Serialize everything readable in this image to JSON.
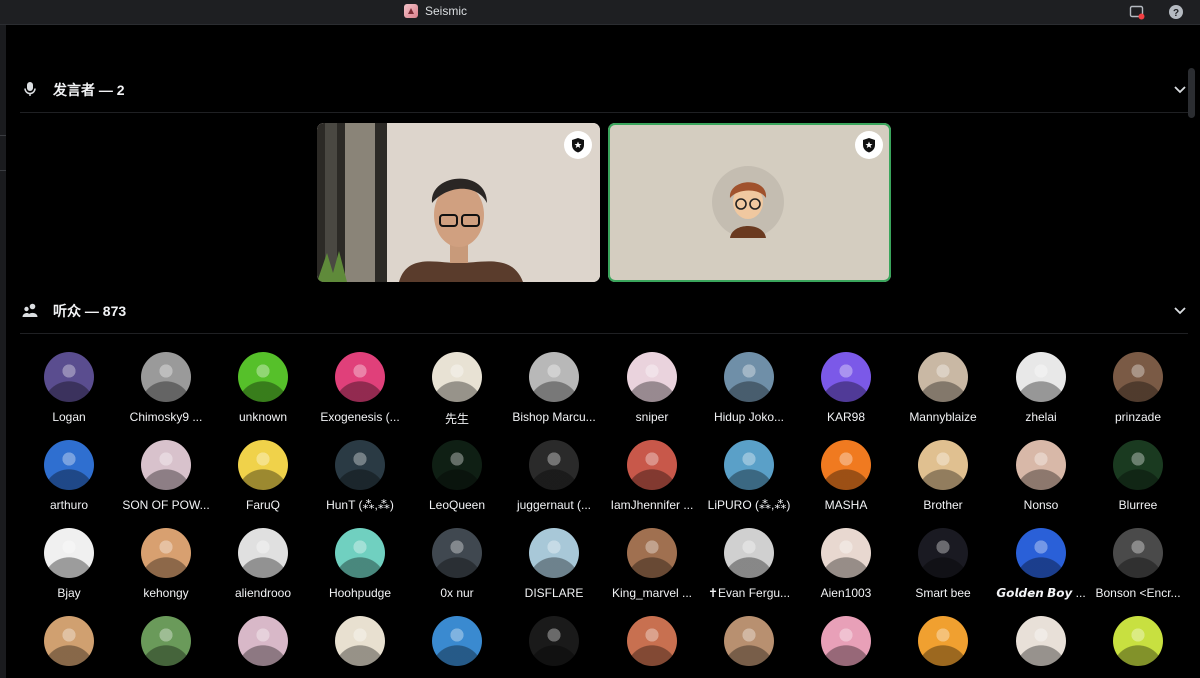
{
  "window": {
    "title": "Seismic"
  },
  "speakers": {
    "title": "发言者 — 2",
    "icon": "microphone-icon"
  },
  "audience": {
    "title": "听众 — 873",
    "icon": "people-icon",
    "members": [
      {
        "name": "Logan",
        "color": "#5a4d8f"
      },
      {
        "name": "Chimosky9 ...",
        "color": "#9a9a9a"
      },
      {
        "name": "unknown",
        "color": "#56c02a"
      },
      {
        "name": "Exogenesis (...",
        "color": "#e0407a"
      },
      {
        "name": "先生",
        "color": "#e8e2d4"
      },
      {
        "name": "Bishop Marcu...",
        "color": "#b8b8b8"
      },
      {
        "name": "sniper",
        "color": "#ead3dd"
      },
      {
        "name": "Hidup Joko...",
        "color": "#6f8fa8"
      },
      {
        "name": "KAR98",
        "color": "#7b59e8"
      },
      {
        "name": "Mannyblaize",
        "color": "#c9b8a4"
      },
      {
        "name": "zhelai",
        "color": "#e8e8e8"
      },
      {
        "name": "prinzade",
        "color": "#7a5a45"
      },
      {
        "name": "arthuro",
        "color": "#2f6fd0"
      },
      {
        "name": "SON OF POW...",
        "color": "#d8c2cc"
      },
      {
        "name": "FaruQ",
        "color": "#f0d24a"
      },
      {
        "name": "HunT (⁂,⁂)",
        "color": "#2a3a44"
      },
      {
        "name": "LeoQueen",
        "color": "#0f1f14"
      },
      {
        "name": "juggernaut (...",
        "color": "#2a2a2a"
      },
      {
        "name": "IamJhennifer ...",
        "color": "#c8584a"
      },
      {
        "name": "LiPURO (⁂,⁂)",
        "color": "#5aa0c8"
      },
      {
        "name": "MASHA",
        "color": "#f07a20"
      },
      {
        "name": "Brother",
        "color": "#e0c090"
      },
      {
        "name": "Nonso",
        "color": "#d8b8a8"
      },
      {
        "name": "Blurree",
        "color": "#1a3a20"
      },
      {
        "name": "Bjay",
        "color": "#f0f0f0"
      },
      {
        "name": "kehongy",
        "color": "#d8a070"
      },
      {
        "name": "aliendrooo",
        "color": "#e0e0e0"
      },
      {
        "name": "Hoohpudge",
        "color": "#70d0c0"
      },
      {
        "name": "0x nur",
        "color": "#404850"
      },
      {
        "name": "DISFLARE",
        "color": "#a8c8d8"
      },
      {
        "name": "King_marvel ...",
        "color": "#a07050"
      },
      {
        "name": "✝Evan Fergu...",
        "color": "#d0d0d0"
      },
      {
        "name": "Aien1003",
        "color": "#e8d8d0"
      },
      {
        "name": "Smart bee",
        "color": "#1a1a22"
      },
      {
        "name": "𝙂𝙤𝙡𝙙𝙚𝙣 𝘽𝙤𝙮 ...",
        "color": "#2a60d8"
      },
      {
        "name": "Bonson <Encr...",
        "color": "#4a4a4a"
      },
      {
        "name": "",
        "color": "#d0a070"
      },
      {
        "name": "",
        "color": "#6a9a5a"
      },
      {
        "name": "",
        "color": "#d8b8c8"
      },
      {
        "name": "",
        "color": "#e8e0d0"
      },
      {
        "name": "",
        "color": "#3a8ad0"
      },
      {
        "name": "",
        "color": "#1a1a1a"
      },
      {
        "name": "",
        "color": "#c87050"
      },
      {
        "name": "",
        "color": "#b89070"
      },
      {
        "name": "",
        "color": "#e8a0b8"
      },
      {
        "name": "",
        "color": "#f0a030"
      },
      {
        "name": "",
        "color": "#e8e0d8"
      },
      {
        "name": "",
        "color": "#c8e040"
      }
    ]
  }
}
